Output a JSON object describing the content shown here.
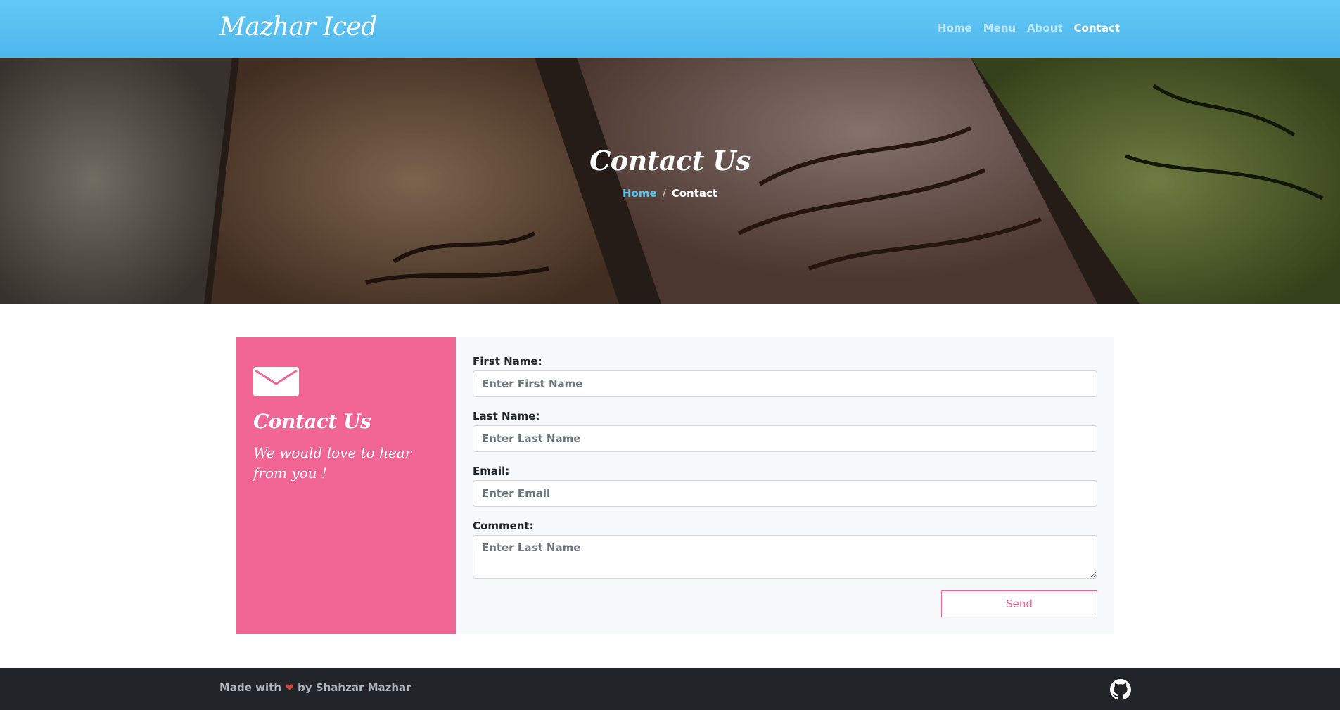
{
  "navbar": {
    "brand": "Mazhar Iced",
    "links": [
      {
        "label": "Home",
        "active": false
      },
      {
        "label": "Menu",
        "active": false
      },
      {
        "label": "About",
        "active": false
      },
      {
        "label": "Contact",
        "active": true
      }
    ]
  },
  "hero": {
    "title": "Contact Us",
    "breadcrumb": {
      "home": "Home",
      "separator": "/",
      "current": "Contact"
    }
  },
  "contact_card": {
    "icon": "envelope-icon",
    "title": "Contact Us",
    "subtitle": "We would love to hear from you !",
    "accent_color": "#f06593"
  },
  "form": {
    "first_name": {
      "label": "First Name:",
      "placeholder": "Enter First Name",
      "value": ""
    },
    "last_name": {
      "label": "Last Name:",
      "placeholder": "Enter Last Name",
      "value": ""
    },
    "email": {
      "label": "Email:",
      "placeholder": "Enter Email",
      "value": ""
    },
    "comment": {
      "label": "Comment:",
      "placeholder": "Enter Last Name",
      "value": ""
    },
    "submit_label": "Send"
  },
  "footer": {
    "made_with": "Made with",
    "heart": "❤",
    "by": "by Shahzar Mazhar",
    "icon": "github-icon"
  },
  "colors": {
    "navbar": "#4db7ee",
    "accent": "#f06593",
    "footer": "#212529"
  }
}
